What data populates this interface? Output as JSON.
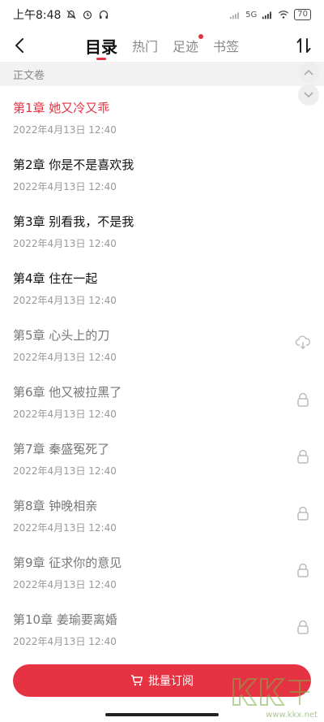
{
  "status_bar": {
    "time": "上午8:48",
    "battery": "70",
    "network": "5G"
  },
  "nav": {
    "tabs": [
      {
        "label": "目录",
        "active": true,
        "dot": false
      },
      {
        "label": "热门",
        "active": false,
        "dot": false
      },
      {
        "label": "足迹",
        "active": false,
        "dot": true
      },
      {
        "label": "书签",
        "active": false,
        "dot": false
      }
    ]
  },
  "section": {
    "title": "正文卷"
  },
  "chapters": [
    {
      "title": "第1章 她又冷又乖",
      "date": "2022年4月13日 12:40",
      "state": "current"
    },
    {
      "title": "第2章 你是不是喜欢我",
      "date": "2022年4月13日 12:40",
      "state": "free"
    },
    {
      "title": "第3章 别看我，不是我",
      "date": "2022年4月13日 12:40",
      "state": "free"
    },
    {
      "title": "第4章 住在一起",
      "date": "2022年4月13日 12:40",
      "state": "free"
    },
    {
      "title": "第5章 心头上的刀",
      "date": "2022年4月13日 12:40",
      "state": "cloud"
    },
    {
      "title": "第6章 他又被拉黑了",
      "date": "2022年4月13日 12:40",
      "state": "locked"
    },
    {
      "title": "第7章 秦盛冤死了",
      "date": "2022年4月13日 12:40",
      "state": "locked"
    },
    {
      "title": "第8章 钟晚相亲",
      "date": "2022年4月13日 12:40",
      "state": "locked"
    },
    {
      "title": "第9章 征求你的意见",
      "date": "2022年4月13日 12:40",
      "state": "locked"
    },
    {
      "title": "第10章 姜瑜要离婚",
      "date": "2022年4月13日 12:40",
      "state": "locked"
    }
  ],
  "bottom": {
    "batch_label": "批量订阅"
  },
  "watermark": {
    "text": "www.kkx.net"
  },
  "colors": {
    "accent": "#e53343",
    "section_bg": "#f2f2f2"
  }
}
